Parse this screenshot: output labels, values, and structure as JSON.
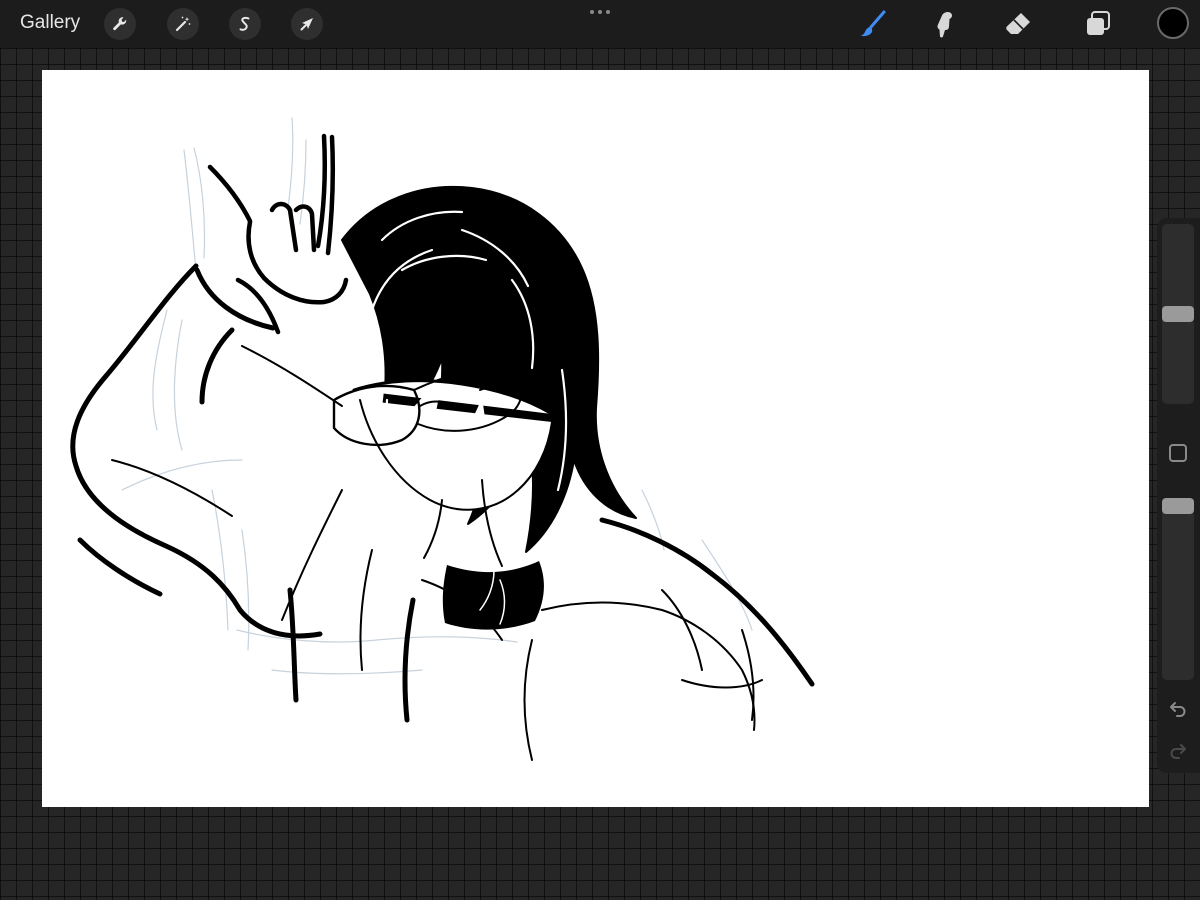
{
  "topbar": {
    "gallery_label": "Gallery",
    "left_tools": [
      {
        "icon": "wrench-icon",
        "name": "actions-button"
      },
      {
        "icon": "magic-wand-icon",
        "name": "adjustments-button"
      },
      {
        "icon": "selection-icon",
        "name": "selection-button"
      },
      {
        "icon": "arrow-cursor-icon",
        "name": "transform-button"
      }
    ],
    "right_tools": [
      {
        "icon": "brush-icon",
        "name": "paint-tool-button",
        "active": true
      },
      {
        "icon": "smudge-icon",
        "name": "smudge-tool-button",
        "active": false
      },
      {
        "icon": "eraser-icon",
        "name": "eraser-tool-button",
        "active": false
      },
      {
        "icon": "layers-icon",
        "name": "layers-button",
        "active": false
      }
    ],
    "current_color": "#000000",
    "active_tool_color": "#3f8cf5"
  },
  "sidebar": {
    "brush_size_level": 0.5,
    "brush_opacity_level": 1.0,
    "undo_icon": "undo-icon",
    "redo_icon": "redo-icon"
  },
  "canvas": {
    "background": "#ffffff",
    "artwork": "ink-sketch"
  }
}
